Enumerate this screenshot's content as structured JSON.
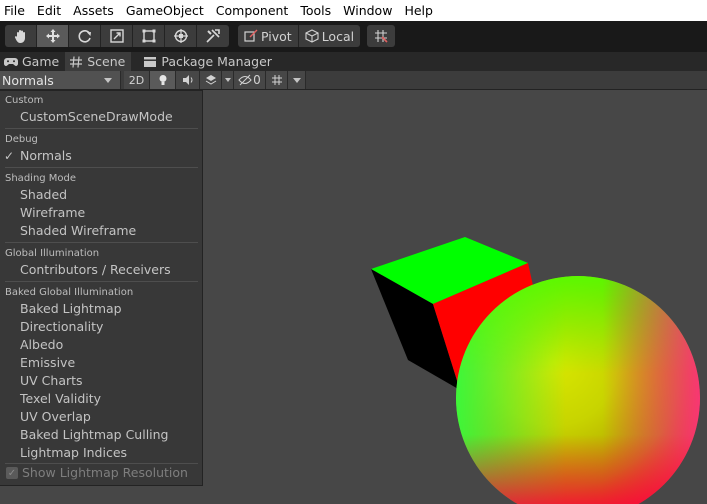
{
  "menu": [
    "File",
    "Edit",
    "Assets",
    "GameObject",
    "Component",
    "Tools",
    "Window",
    "Help"
  ],
  "toolbar": {
    "tools": [
      "hand-icon",
      "move-icon",
      "rotate-icon",
      "scale-icon",
      "rect-icon",
      "transform-icon",
      "custom-tool-icon"
    ],
    "active_tool": "move-icon",
    "pivot_label": "Pivot",
    "local_label": "Local",
    "snap_icon": "grid-snap-icon"
  },
  "tabs": [
    {
      "label": "Game",
      "icon": "gamepad-icon",
      "active": false
    },
    {
      "label": "Scene",
      "icon": "hash-icon",
      "active": true
    },
    {
      "label": "Package Manager",
      "icon": "package-icon",
      "active": false
    }
  ],
  "scene_toolbar": {
    "draw_mode": "Normals",
    "mode_2d_label": "2D",
    "hidden_count": "0"
  },
  "dropdown": {
    "sections": [
      {
        "header": "Custom",
        "items": [
          "CustomSceneDrawMode"
        ]
      },
      {
        "header": "Debug",
        "items": [
          "Normals"
        ]
      },
      {
        "header": "Shading Mode",
        "items": [
          "Shaded",
          "Wireframe",
          "Shaded Wireframe"
        ]
      },
      {
        "header": "Global Illumination",
        "items": [
          "Contributors / Receivers"
        ]
      },
      {
        "header": "Baked Global Illumination",
        "items": [
          "Baked Lightmap",
          "Directionality",
          "Albedo",
          "Emissive",
          "UV Charts",
          "Texel Validity",
          "UV Overlap",
          "Baked Lightmap Culling",
          "Lightmap Indices"
        ]
      }
    ],
    "checked_item": "Normals",
    "check_glyph": "✓",
    "bottom_toggle": "Show Lightmap Resolution"
  },
  "colors": {
    "cube_top": "#00ff00",
    "cube_front": "#ff0000",
    "cube_side": "#000000",
    "viewport_bg": "#474747"
  }
}
